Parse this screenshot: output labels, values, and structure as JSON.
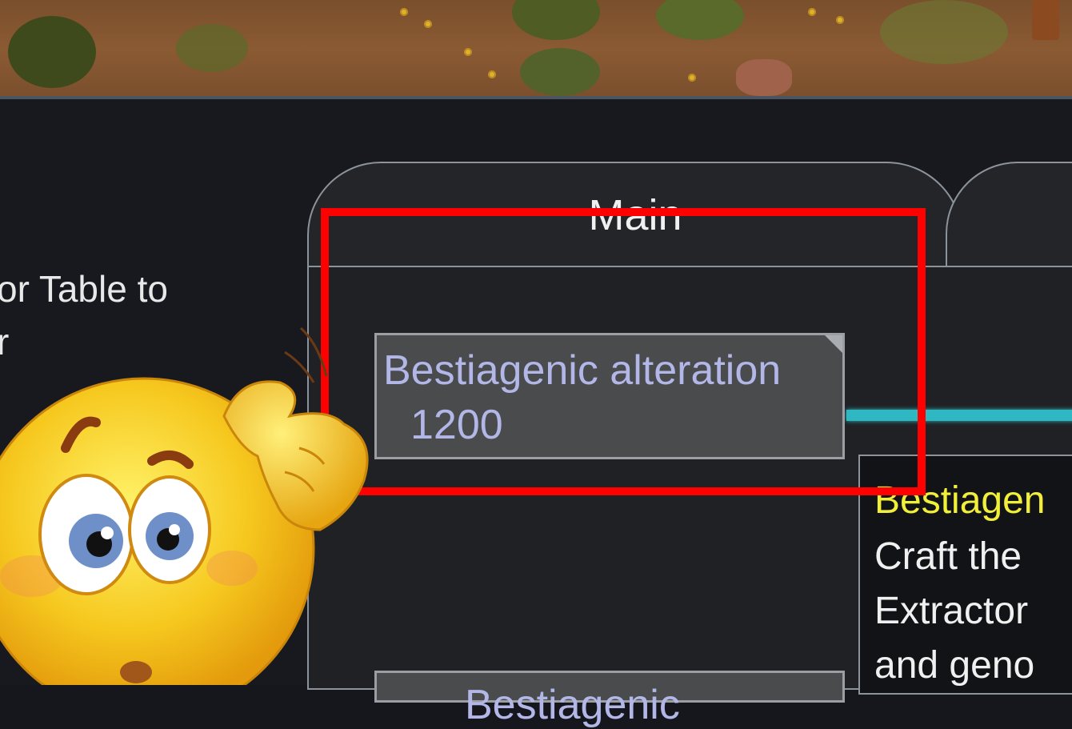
{
  "side_panel": {
    "line1": "or Table to",
    "line2": "r"
  },
  "tabs": {
    "main_label": "Main"
  },
  "research_node": {
    "title": "Bestiagenic alteration",
    "cost": "1200"
  },
  "research_node_2": {
    "title": "Bestiagenic"
  },
  "tooltip": {
    "title": "Bestiagen",
    "lines": [
      "Craft the ",
      "Extractor ",
      "and geno"
    ]
  },
  "colors": {
    "highlight": "#ff0000",
    "node_text": "#b3b7e8",
    "tooltip_title": "#f2ef3a",
    "connector": "#2fb8c2"
  },
  "icons": {
    "emoji": "confused-thinking-emoji"
  }
}
